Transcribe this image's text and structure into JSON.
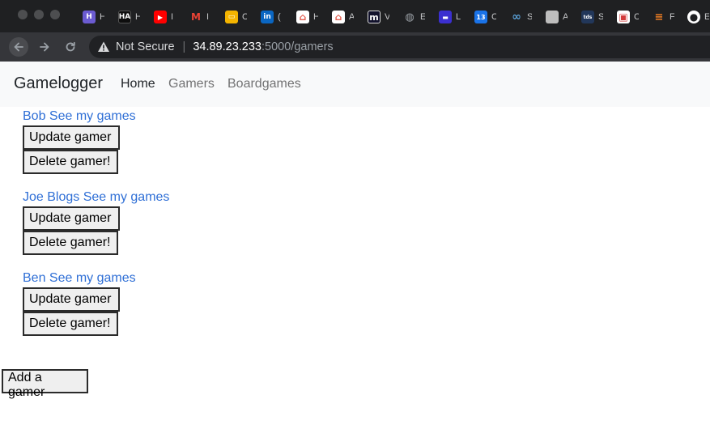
{
  "browser": {
    "tabs": [
      {
        "icon": "heroku-icon",
        "glyph": "H",
        "color": "#6b5bd1",
        "title": "H"
      },
      {
        "icon": "hackerearth-icon",
        "glyph": "HA",
        "color": "#0e0e0e",
        "title": "H"
      },
      {
        "icon": "youtube-icon",
        "glyph": "▶",
        "color": "#ff0000",
        "title": "I"
      },
      {
        "icon": "gmail-icon",
        "glyph": "M",
        "color": "#1f2022",
        "title": "I"
      },
      {
        "icon": "slides-icon",
        "glyph": "▭",
        "color": "#f4b400",
        "title": "C"
      },
      {
        "icon": "linkedin-icon",
        "glyph": "in",
        "color": "#0a66c2",
        "title": "("
      },
      {
        "icon": "home-icon",
        "glyph": "⌂",
        "color": "#e35d4f",
        "title": "H"
      },
      {
        "icon": "home-icon",
        "glyph": "⌂",
        "color": "#e35d4f",
        "title": "A"
      },
      {
        "icon": "medium-icon",
        "glyph": "m",
        "color": "#12122c",
        "title": "V"
      },
      {
        "icon": "globe-icon",
        "glyph": "◍",
        "color": "#5f6368",
        "title": "E"
      },
      {
        "icon": "dashboard-icon",
        "glyph": "▬",
        "color": "#3b2fd0",
        "title": "L"
      },
      {
        "icon": "calendar-icon",
        "glyph": "13",
        "color": "#1a73e8",
        "title": "C"
      },
      {
        "icon": "cloud-icon",
        "glyph": "∞",
        "color": "#5aa1d8",
        "title": "S"
      },
      {
        "icon": "blank-icon",
        "glyph": "",
        "color": "#bdbdbd",
        "title": "A"
      },
      {
        "icon": "tds-icon",
        "glyph": "tds",
        "color": "#22375a",
        "title": "S"
      },
      {
        "icon": "trello-icon",
        "glyph": "▣",
        "color": "#d33b3b",
        "title": "C"
      },
      {
        "icon": "stackoverflow-icon",
        "glyph": "≡",
        "color": "#f48024",
        "title": "F"
      },
      {
        "icon": "github-icon",
        "glyph": "●",
        "color": "#1f2022",
        "title": "E"
      }
    ],
    "security_label": "Not Secure",
    "url_host": "34.89.23.233",
    "url_path": ":5000/gamers"
  },
  "navbar": {
    "brand": "Gamelogger",
    "links": [
      "Home",
      "Gamers",
      "Boardgames"
    ]
  },
  "gamers": [
    {
      "link": "Bob See my games",
      "update_label": "Update gamer",
      "delete_label": "Delete gamer!"
    },
    {
      "link": "Joe Blogs See my games",
      "update_label": "Update gamer",
      "delete_label": "Delete gamer!"
    },
    {
      "link": "Ben See my games",
      "update_label": "Update gamer",
      "delete_label": "Delete gamer!"
    }
  ],
  "add_gamer_label": "Add a gamer",
  "colors": {
    "link": "#2f6fd6",
    "navbar_bg": "#f8f9fa",
    "chrome_bg": "#35363a"
  }
}
